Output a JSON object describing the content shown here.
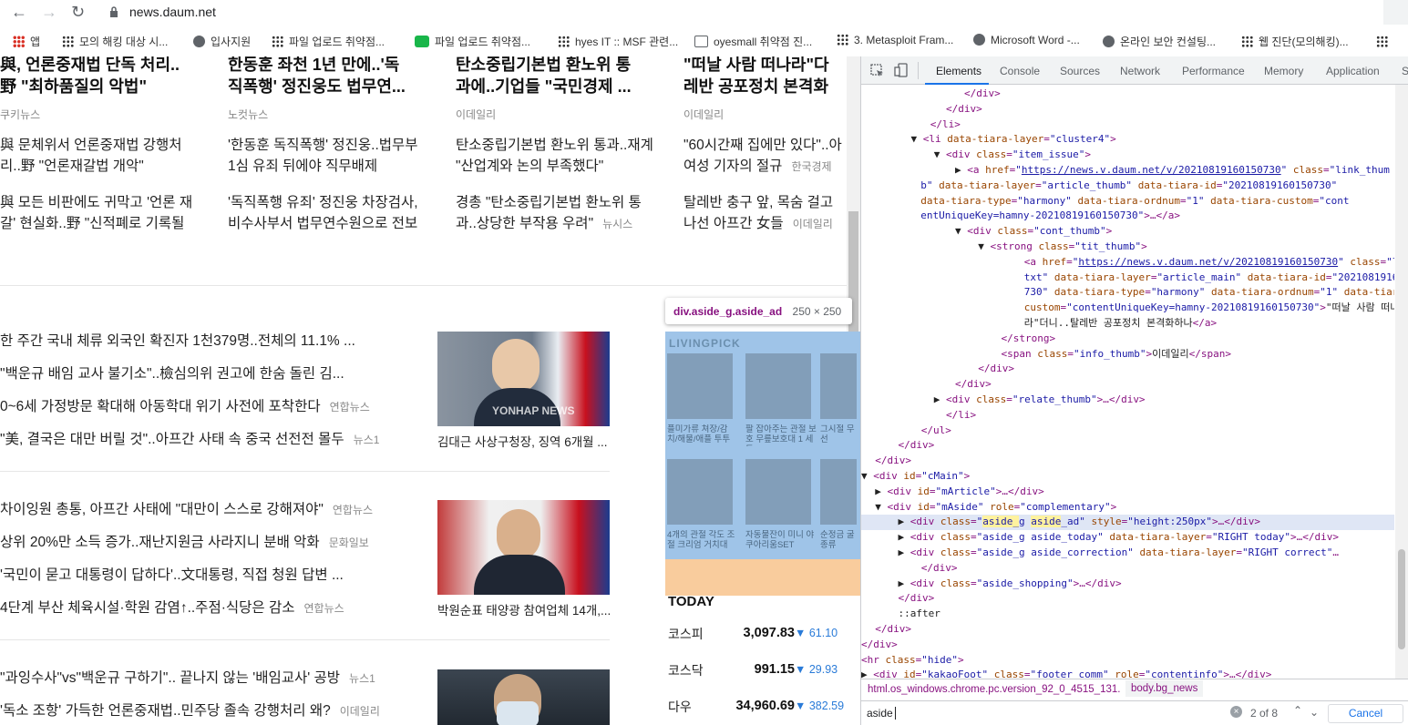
{
  "browser": {
    "url": "news.daum.net"
  },
  "bookmarks": [
    {
      "label": "앱",
      "icon": "apps-grid-icon"
    },
    {
      "label": "모의 해킹 대상 시...",
      "icon": "dots-icon"
    },
    {
      "label": "입사지원",
      "icon": "globe-icon"
    },
    {
      "label": "파일 업로드 취약점...",
      "icon": "dots-icon"
    },
    {
      "label": "파일 업로드 취약점...",
      "icon": "blog-icon"
    },
    {
      "label": "hyes IT :: MSF 관련...",
      "icon": "dots-icon"
    },
    {
      "label": "oyesmall 취약점 진...",
      "icon": "image-icon"
    },
    {
      "label": "3. Metasploit Fram...",
      "icon": "dots-icon"
    },
    {
      "label": "Microsoft Word -...",
      "icon": "globe-icon"
    },
    {
      "label": "온라인 보안 컨설팅...",
      "icon": "globe-icon"
    },
    {
      "label": "웹 진단(모의해킹)...",
      "icon": "dots-icon"
    }
  ],
  "top_news": [
    {
      "title1": "與, 언론중재법 단독 처리..",
      "title2": "野 \"최하품질의 악법\"",
      "source": "쿠키뉴스",
      "rel1a": "與 문체위서 언론중재법 강행처",
      "rel1b": "리..野 \"언론재갈법 개악\"",
      "rel2a": "與 모든 비판에도 귀막고 '언론 재",
      "rel2b": "갈' 현실화..野 \"신적폐로 기록될"
    },
    {
      "title1": "한동훈 좌천 1년 만에..'독",
      "title2": "직폭행' 정진웅도 법무연...",
      "source": "노컷뉴스",
      "rel1a": "'한동훈 독직폭행' 정진웅..법무부",
      "rel1b": "1심 유죄 뒤에야 직무배제",
      "rel2a": "'독직폭행 유죄' 정진웅 차장검사,",
      "rel2b": "비수사부서 법무연수원으로 전보"
    },
    {
      "title1": "탄소중립기본법 환노위 통",
      "title2": "과에..기업들 \"국민경제 ...",
      "source": "이데일리",
      "rel1a": "탄소중립기본법 환노위 통과..재계",
      "rel1b": "\"산업계와 논의 부족했다\"",
      "rel2a": "경총 \"탄소중립기본법 환노위 통",
      "rel2b": "과..상당한 부작용 우려\"",
      "rel2src": "뉴시스"
    },
    {
      "title1": "\"떠날 사람 떠나라\"다",
      "title2": "레반 공포정치 본격화",
      "source": "이데일리",
      "rel1a": "\"60시간째 집에만 있다\"..아",
      "rel1b": "여성 기자의 절규",
      "rel1src": "한국경제",
      "rel2a": "탈레반 충구 앞, 목숨 걸고",
      "rel2b": "나선 아프간 女들",
      "rel2src": "이데일리"
    }
  ],
  "news_blocks": [
    {
      "items": [
        {
          "text": "한 주간 국내 체류 외국인 확진자 1천379명..전체의 11.1% ...",
          "more": "...",
          "source": ""
        },
        {
          "text": "\"백운규 배임 교사 불기소\"..檢심의위 권고에 한숨 돌린 김...",
          "more": "...",
          "source": ""
        },
        {
          "text": "0~6세 가정방문 확대해 아동학대 위기 사전에 포착한다",
          "source": "연합뉴스"
        },
        {
          "text": "\"美, 결국은 대만 버릴 것\"..아프간 사태 속 중국 선전전 몰두",
          "source": "뉴스1"
        }
      ],
      "caption": "김대근 사상구청장, 징역 6개월 ...",
      "watermark": "YONHAP NEWS"
    },
    {
      "items": [
        {
          "text": "차이잉원 총통, 아프간 사태에 \"대만이 스스로 강해져야\"",
          "source": "연합뉴스"
        },
        {
          "text": "상위 20%만 소득 증가..재난지원금 사라지니 분배 악화",
          "source": "문화일보"
        },
        {
          "text": "'국민이 묻고 대통령이 답하다'..文대통령, 직접 청원 답변 ...",
          "source": ""
        },
        {
          "text": "4단계 부산 체육시설·학원 감염↑..주점·식당은 감소",
          "source": "연합뉴스"
        }
      ],
      "caption": "박원순표 태양광 참여업체 14개,..."
    },
    {
      "items": [
        {
          "text": "\"과잉수사\"vs\"백운규 구하기\".. 끝나지 않는 '배임교사' 공방",
          "source": "뉴스1"
        },
        {
          "text": "'독소 조항' 가득한 언론중재법..민주당 졸속 강행처리 왜?",
          "source": "이데일리"
        }
      ]
    }
  ],
  "ad": {
    "brand": "LIVINGPICK",
    "items": [
      "플미가류 쳐장/감 치/해물/애플 투투",
      "팔 잡아주는 관절 보호 무릎보호대 1 세트",
      "그시절 무선",
      "4개의 관절 각도 조 절 크리엄 거치대",
      "자동물잔이 미니 야쿠아리움SET",
      "순정금 굴 종류"
    ]
  },
  "tooltip": {
    "selector": "div.aside_g.aside_ad",
    "size": "250 × 250"
  },
  "today": {
    "title": "TODAY",
    "rows": [
      {
        "name": "코스피",
        "value": "3,097.83",
        "change": "▼ 61.10"
      },
      {
        "name": "코스닥",
        "value": "991.15",
        "change": "▼ 29.93"
      },
      {
        "name": "다우",
        "value": "34,960.69",
        "change": "▼ 382.59"
      }
    ]
  },
  "devtools": {
    "tabs": [
      "Elements",
      "Console",
      "Sources",
      "Network",
      "Performance",
      "Memory",
      "Application",
      "S"
    ],
    "breadcrumbs": [
      "html.os_windows.chrome.pc.version_92_0_4515_131.",
      "body.bg_news"
    ],
    "find": {
      "query": "aside",
      "count": "2 of 8",
      "cancel": "Cancel"
    }
  },
  "colors": {
    "accent": "#1a73e8",
    "ad_overlay": "#9fc4e8",
    "ad_margin": "#f9cc9d",
    "change_blue": "#2a7bd8"
  }
}
